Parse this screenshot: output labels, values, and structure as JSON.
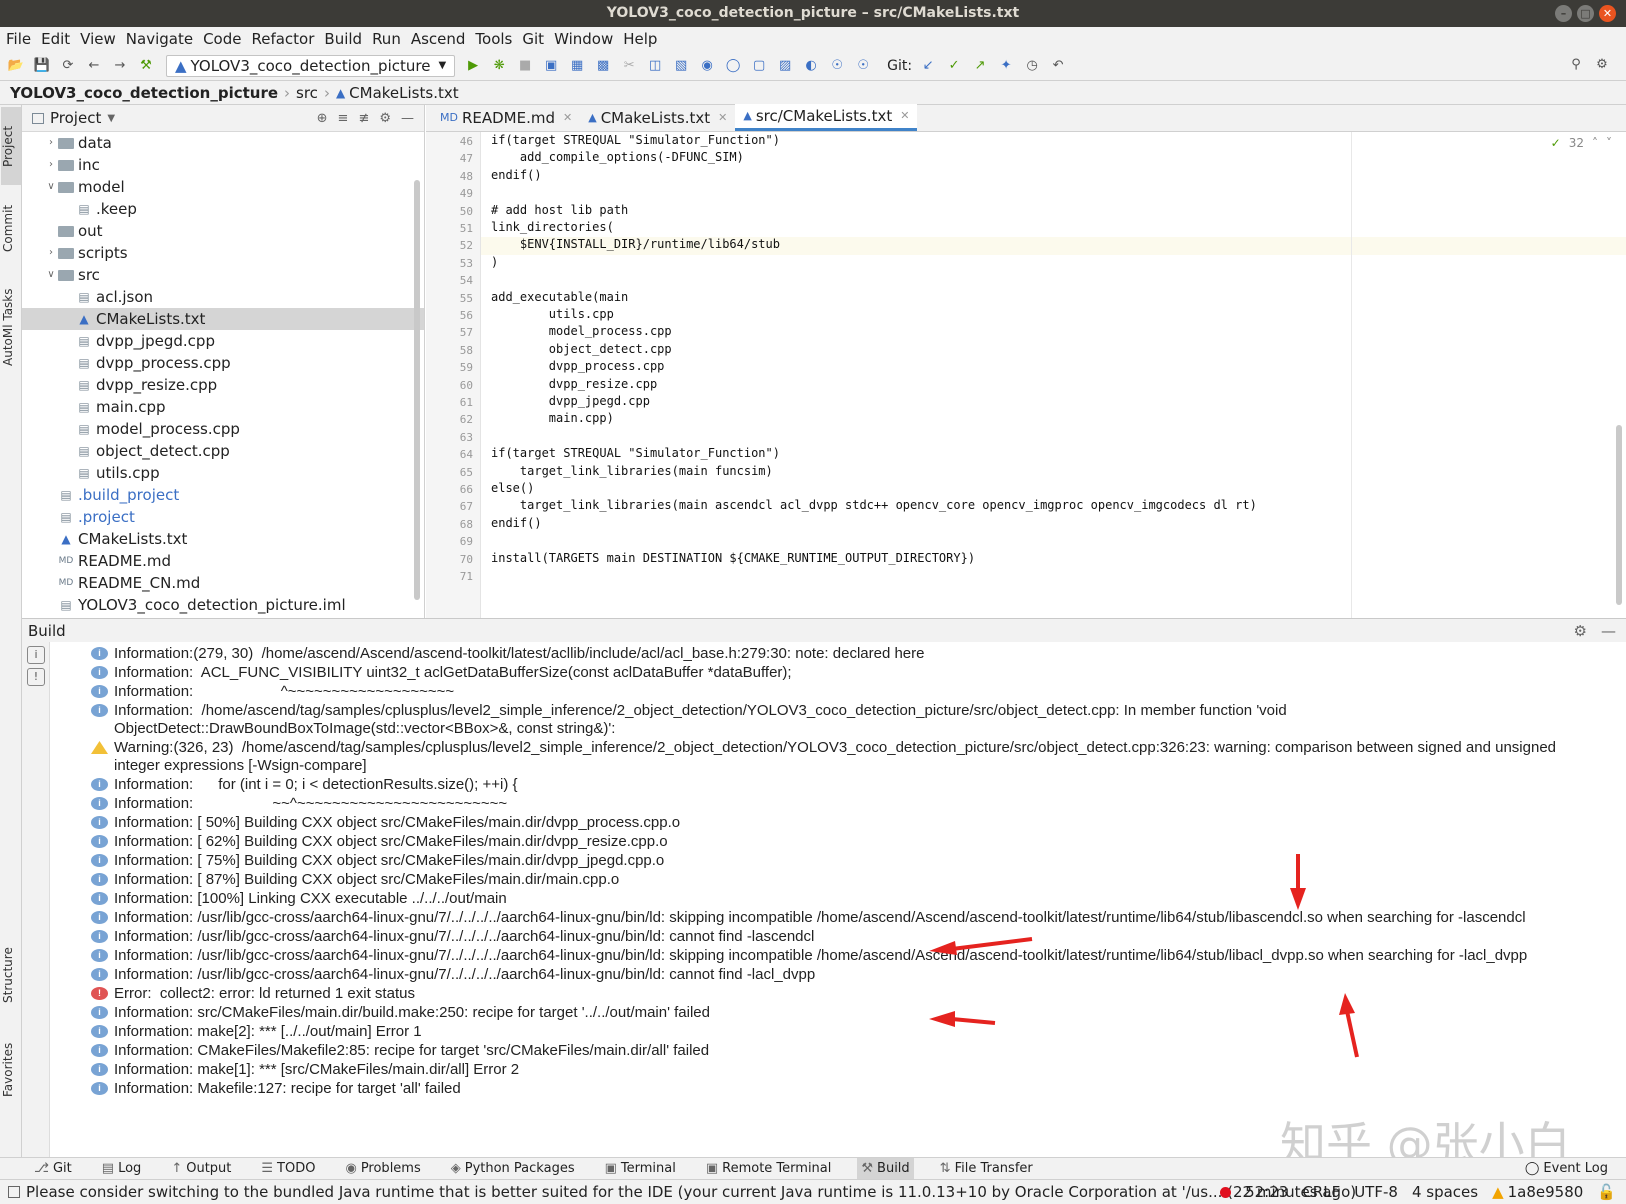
{
  "window": {
    "title": "YOLOV3_coco_detection_picture – src/CMakeLists.txt"
  },
  "menu": [
    "File",
    "Edit",
    "View",
    "Navigate",
    "Code",
    "Refactor",
    "Build",
    "Run",
    "Ascend",
    "Tools",
    "Git",
    "Window",
    "Help"
  ],
  "toolbar": {
    "run_config": "YOLOV3_coco_detection_picture",
    "git_label": "Git:"
  },
  "breadcrumb": [
    "YOLOV3_coco_detection_picture",
    "src",
    "CMakeLists.txt"
  ],
  "left_strip": {
    "project": "Project",
    "commit": "Commit",
    "automl": "AutoMl Tasks",
    "structure": "Structure",
    "favorites": "Favorites"
  },
  "project_panel": {
    "title": "Project",
    "items": [
      {
        "label": "data",
        "type": "folder",
        "level": 1,
        "expand": "collapsed"
      },
      {
        "label": "inc",
        "type": "folder",
        "level": 1,
        "expand": "collapsed"
      },
      {
        "label": "model",
        "type": "folder",
        "level": 1,
        "expand": "expanded"
      },
      {
        "label": ".keep",
        "type": "file",
        "level": 2,
        "expand": ""
      },
      {
        "label": "out",
        "type": "folder",
        "level": 1,
        "expand": ""
      },
      {
        "label": "scripts",
        "type": "folder",
        "level": 1,
        "expand": "collapsed"
      },
      {
        "label": "src",
        "type": "folder",
        "level": 1,
        "expand": "expanded"
      },
      {
        "label": "acl.json",
        "type": "file",
        "level": 2,
        "expand": ""
      },
      {
        "label": "CMakeLists.txt",
        "type": "cmake",
        "level": 2,
        "expand": "",
        "selected": true
      },
      {
        "label": "dvpp_jpegd.cpp",
        "type": "file",
        "level": 2,
        "expand": ""
      },
      {
        "label": "dvpp_process.cpp",
        "type": "file",
        "level": 2,
        "expand": ""
      },
      {
        "label": "dvpp_resize.cpp",
        "type": "file",
        "level": 2,
        "expand": ""
      },
      {
        "label": "main.cpp",
        "type": "file",
        "level": 2,
        "expand": ""
      },
      {
        "label": "model_process.cpp",
        "type": "file",
        "level": 2,
        "expand": ""
      },
      {
        "label": "object_detect.cpp",
        "type": "file",
        "level": 2,
        "expand": ""
      },
      {
        "label": "utils.cpp",
        "type": "file",
        "level": 2,
        "expand": ""
      },
      {
        "label": ".build_project",
        "type": "file",
        "level": 1,
        "expand": "",
        "color": "blue"
      },
      {
        "label": ".project",
        "type": "file",
        "level": 1,
        "expand": "",
        "color": "blue"
      },
      {
        "label": "CMakeLists.txt",
        "type": "cmake",
        "level": 1,
        "expand": ""
      },
      {
        "label": "README.md",
        "type": "md",
        "level": 1,
        "expand": ""
      },
      {
        "label": "README_CN.md",
        "type": "md",
        "level": 1,
        "expand": ""
      },
      {
        "label": "YOLOV3_coco_detection_picture.iml",
        "type": "file",
        "level": 1,
        "expand": ""
      }
    ]
  },
  "editor": {
    "tabs": [
      {
        "label": "README.md",
        "active": false
      },
      {
        "label": "CMakeLists.txt",
        "active": false
      },
      {
        "label": "src/CMakeLists.txt",
        "active": true
      }
    ],
    "inspection_count": "32",
    "current_line": "52",
    "lines": [
      {
        "n": "46",
        "t": "if(target STREQUAL \"Simulator_Function\")"
      },
      {
        "n": "47",
        "t": "    add_compile_options(-DFUNC_SIM)"
      },
      {
        "n": "48",
        "t": "endif()"
      },
      {
        "n": "49",
        "t": ""
      },
      {
        "n": "50",
        "t": "# add host lib path"
      },
      {
        "n": "51",
        "t": "link_directories("
      },
      {
        "n": "52",
        "t": "    $ENV{INSTALL_DIR}/runtime/lib64/stub"
      },
      {
        "n": "53",
        "t": ")"
      },
      {
        "n": "54",
        "t": ""
      },
      {
        "n": "55",
        "t": "add_executable(main"
      },
      {
        "n": "56",
        "t": "        utils.cpp"
      },
      {
        "n": "57",
        "t": "        model_process.cpp"
      },
      {
        "n": "58",
        "t": "        object_detect.cpp"
      },
      {
        "n": "59",
        "t": "        dvpp_process.cpp"
      },
      {
        "n": "60",
        "t": "        dvpp_resize.cpp"
      },
      {
        "n": "61",
        "t": "        dvpp_jpegd.cpp"
      },
      {
        "n": "62",
        "t": "        main.cpp)"
      },
      {
        "n": "63",
        "t": ""
      },
      {
        "n": "64",
        "t": "if(target STREQUAL \"Simulator_Function\")"
      },
      {
        "n": "65",
        "t": "    target_link_libraries(main funcsim)"
      },
      {
        "n": "66",
        "t": "else()"
      },
      {
        "n": "67",
        "t": "    target_link_libraries(main ascendcl acl_dvpp stdc++ opencv_core opencv_imgproc opencv_imgcodecs dl rt)"
      },
      {
        "n": "68",
        "t": "endif()"
      },
      {
        "n": "69",
        "t": ""
      },
      {
        "n": "70",
        "t": "install(TARGETS main DESTINATION ${CMAKE_RUNTIME_OUTPUT_DIRECTORY})"
      },
      {
        "n": "71",
        "t": ""
      }
    ]
  },
  "build_panel": {
    "title": "Build",
    "entries": [
      {
        "level": "info",
        "text": "Information:(279, 30)  /home/ascend/Ascend/ascend-toolkit/latest/acllib/include/acl/acl_base.h:279:30: note: declared here"
      },
      {
        "level": "info",
        "text": "Information:  ACL_FUNC_VISIBILITY uint32_t aclGetDataBufferSize(const aclDataBuffer *dataBuffer);"
      },
      {
        "level": "info",
        "text": "Information:                     ^~~~~~~~~~~~~~~~~~~~"
      },
      {
        "level": "info",
        "text": "Information:  /home/ascend/tag/samples/cplusplus/level2_simple_inference/2_object_detection/YOLOV3_coco_detection_picture/src/object_detect.cpp: In member function 'void ObjectDetect::DrawBoundBoxToImage(std::vector<BBox>&, const string&)':"
      },
      {
        "level": "warn",
        "text": "Warning:(326, 23)  /home/ascend/tag/samples/cplusplus/level2_simple_inference/2_object_detection/YOLOV3_coco_detection_picture/src/object_detect.cpp:326:23: warning: comparison between signed and unsigned integer expressions [-Wsign-compare]"
      },
      {
        "level": "info",
        "text": "Information:      for (int i = 0; i < detectionResults.size(); ++i) {"
      },
      {
        "level": "info",
        "text": "Information:                   ~~^~~~~~~~~~~~~~~~~~~~~~~~~"
      },
      {
        "level": "info",
        "text": "Information: [ 50%] Building CXX object src/CMakeFiles/main.dir/dvpp_process.cpp.o"
      },
      {
        "level": "info",
        "text": "Information: [ 62%] Building CXX object src/CMakeFiles/main.dir/dvpp_resize.cpp.o"
      },
      {
        "level": "info",
        "text": "Information: [ 75%] Building CXX object src/CMakeFiles/main.dir/dvpp_jpegd.cpp.o"
      },
      {
        "level": "info",
        "text": "Information: [ 87%] Building CXX object src/CMakeFiles/main.dir/main.cpp.o"
      },
      {
        "level": "info",
        "text": "Information: [100%] Linking CXX executable ../../../out/main"
      },
      {
        "level": "info",
        "text": "Information: /usr/lib/gcc-cross/aarch64-linux-gnu/7/../../../../aarch64-linux-gnu/bin/ld: skipping incompatible /home/ascend/Ascend/ascend-toolkit/latest/runtime/lib64/stub/libascendcl.so when searching for -lascendcl"
      },
      {
        "level": "info",
        "text": "Information: /usr/lib/gcc-cross/aarch64-linux-gnu/7/../../../../aarch64-linux-gnu/bin/ld: cannot find -lascendcl"
      },
      {
        "level": "info",
        "text": "Information: /usr/lib/gcc-cross/aarch64-linux-gnu/7/../../../../aarch64-linux-gnu/bin/ld: skipping incompatible /home/ascend/Ascend/ascend-toolkit/latest/runtime/lib64/stub/libacl_dvpp.so when searching for -lacl_dvpp"
      },
      {
        "level": "info",
        "text": "Information: /usr/lib/gcc-cross/aarch64-linux-gnu/7/../../../../aarch64-linux-gnu/bin/ld: cannot find -lacl_dvpp"
      },
      {
        "level": "err",
        "text": "Error:  collect2: error: ld returned 1 exit status"
      },
      {
        "level": "info",
        "text": "Information: src/CMakeFiles/main.dir/build.make:250: recipe for target '../../out/main' failed"
      },
      {
        "level": "info",
        "text": "Information: make[2]: *** [../../out/main] Error 1"
      },
      {
        "level": "info",
        "text": "Information: CMakeFiles/Makefile2:85: recipe for target 'src/CMakeFiles/main.dir/all' failed"
      },
      {
        "level": "info",
        "text": "Information: make[1]: *** [src/CMakeFiles/main.dir/all] Error 2"
      },
      {
        "level": "info",
        "text": "Information: Makefile:127: recipe for target 'all' failed"
      }
    ]
  },
  "bottom_tabs": [
    {
      "label": "Git",
      "icon": "git-icon"
    },
    {
      "label": "Log",
      "icon": "log-icon"
    },
    {
      "label": "Output",
      "icon": "output-icon"
    },
    {
      "label": "TODO",
      "icon": "todo-icon"
    },
    {
      "label": "Problems",
      "icon": "problems-icon"
    },
    {
      "label": "Python Packages",
      "icon": "python-packages-icon"
    },
    {
      "label": "Terminal",
      "icon": "terminal-icon"
    },
    {
      "label": "Remote Terminal",
      "icon": "remote-terminal-icon"
    },
    {
      "label": "Build",
      "icon": "build-icon",
      "selected": true
    },
    {
      "label": "File Transfer",
      "icon": "file-transfer-icon"
    }
  ],
  "event_log": "Event Log",
  "status": {
    "message": "Please consider switching to the bundled Java runtime that is better suited for the IDE (your current Java runtime is 11.0.13+10 by Oracle Corporation at '/us... (22 minutes ago)",
    "position": "52:23",
    "line_sep": "CRLF",
    "encoding": "UTF-8",
    "indent": "4 spaces",
    "vcs": "1a8e9580"
  },
  "watermark": "知乎 @张小白"
}
